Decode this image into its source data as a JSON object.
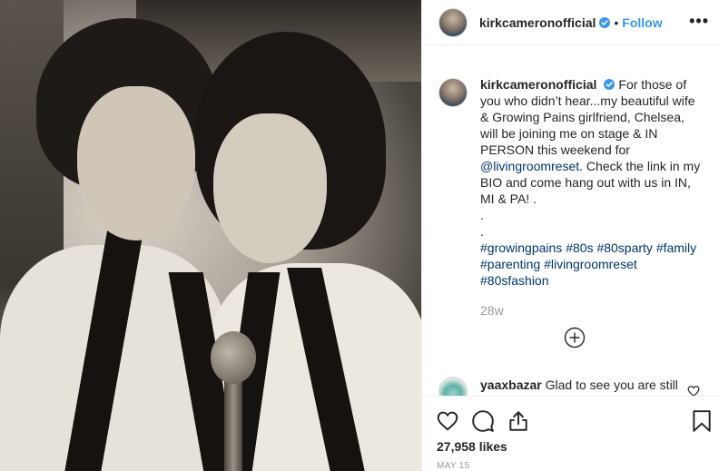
{
  "post": {
    "photo_alt": "",
    "author": {
      "username": "kirkcameronofficial",
      "verified": true
    },
    "header": {
      "separator": "•",
      "follow_label": "Follow",
      "more_label": "•••"
    },
    "caption": {
      "username": "kirkcameronofficial",
      "line1": "For those of you who didn’t hear...my beautiful wife & Growing Pains girlfriend, Chelsea, will be joining me on stage & IN PERSON this weekend for ",
      "mention": "@livingroomreset",
      "line2": ". Check the link in my BIO and come hang out with us in IN, MI & PA! .",
      "dot1": ".",
      "dot2": ".",
      "hashtags": [
        "#growingpains",
        "#80s",
        "#80sparty",
        "#family",
        "#parenting",
        "#livingroomreset",
        "#80sfashion"
      ]
    },
    "age": "28w",
    "comments": [
      {
        "username": "yaaxbazar",
        "text": "Glad to see you are still"
      }
    ],
    "likes": "27,958 likes",
    "date": "MAY 15"
  },
  "icons": {
    "verified": "verified-badge-icon",
    "more": "more-options-icon",
    "load_more": "plus-circle-icon",
    "like": "heart-icon",
    "comment": "comment-bubble-icon",
    "share": "share-icon",
    "save": "bookmark-icon"
  },
  "colors": {
    "link_blue": "#3897f0",
    "hashtag": "#003569",
    "muted": "#999999",
    "text": "#262626"
  }
}
